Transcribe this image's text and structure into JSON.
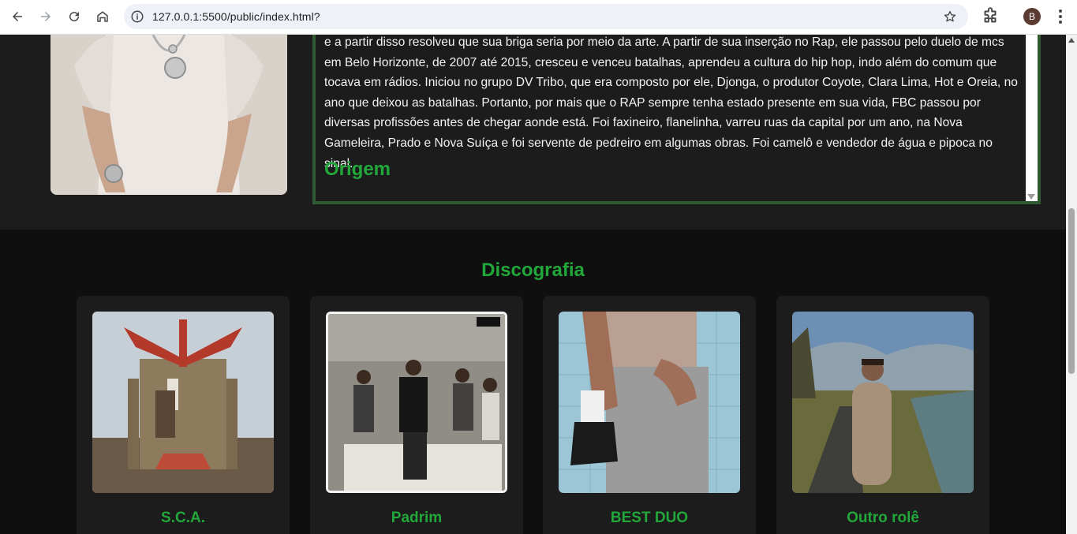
{
  "browser": {
    "url": "127.0.0.1:5500/public/index.html?",
    "profile_initial": "B"
  },
  "bio": {
    "text": "e a partir disso resolveu que sua briga seria por meio da arte. A partir de sua inserção no Rap, ele passou pelo duelo de mcs em Belo Horizonte, de 2007 até 2015, cresceu e venceu batalhas, aprendeu a cultura do hip hop, indo além do comum que tocava em rádios. Iniciou no grupo DV Tribo, que era composto por ele, Djonga, o produtor Coyote, Clara Lima, Hot e Oreia, no ano que deixou as batalhas. Portanto, por mais que o RAP sempre tenha estado presente em sua vida, FBC passou por diversas profissões antes de chegar aonde está. Foi faxineiro, flanelinha, varreu ruas da capital por um ano, na Nova Gameleira, Prado e Nova Suíça e foi servente de pedreiro em algumas obras. Foi camelô e vendedor de água e pipoca no sinal.",
    "heading": "Origem"
  },
  "discography": {
    "title": "Discografia",
    "albums": [
      {
        "title": "S.C.A."
      },
      {
        "title": "Padrim"
      },
      {
        "title": "BEST DUO"
      },
      {
        "title": "Outro rolê"
      }
    ]
  },
  "colors": {
    "accent": "#22a83a",
    "bio_border": "#2f5a32",
    "section_bg": "#1c1c1c",
    "page_bg": "#0f0f0f"
  }
}
